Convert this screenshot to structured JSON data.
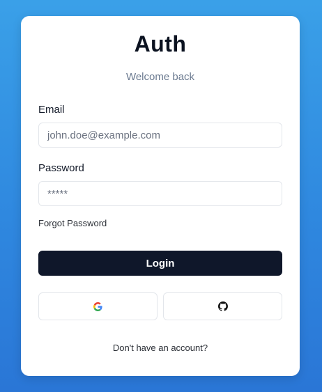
{
  "header": {
    "title": "Auth",
    "subtitle": "Welcome back"
  },
  "form": {
    "email_label": "Email",
    "email_placeholder": "john.doe@example.com",
    "email_value": "",
    "password_label": "Password",
    "password_placeholder": "*****",
    "password_value": "",
    "forgot_label": "Forgot Password",
    "login_label": "Login"
  },
  "social": {
    "buttons": [
      {
        "icon": "google-icon"
      },
      {
        "icon": "github-icon"
      }
    ]
  },
  "footer": {
    "signup_text": "Don't have an account?"
  },
  "colors": {
    "background_top": "#3aa0e8",
    "background_bottom": "#2a76d6",
    "primary_button": "#0f172a"
  }
}
